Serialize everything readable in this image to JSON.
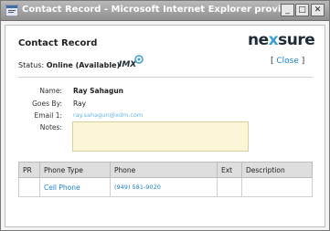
{
  "window": {
    "title": "Contact Record - Microsoft Internet Explorer provided by XDime...",
    "controls": {
      "minimize": "_",
      "maximize": "□",
      "close": "✕"
    }
  },
  "header": {
    "heading": "Contact Record",
    "logo_left": "ne",
    "logo_x": "x",
    "logo_right": "sure",
    "close_open": "[ ",
    "close_label": "Close",
    "close_close": " ]"
  },
  "status": {
    "label": "Status:",
    "value": "Online (Available)",
    "badge": "IMX"
  },
  "contact": {
    "name_label": "Name:",
    "name": "Ray Sahagun",
    "goes_by_label": "Goes By:",
    "goes_by": "Ray",
    "email_label": "Email 1:",
    "email": "ray.sahagun@xdm.com",
    "notes_label": "Notes:",
    "notes": ""
  },
  "phones": {
    "columns": [
      "PR",
      "Phone Type",
      "Phone",
      "Ext",
      "Description"
    ],
    "rows": [
      {
        "pr": "",
        "type": "Cell Phone",
        "phone": "(949) 581-9020",
        "ext": "",
        "description": ""
      }
    ]
  },
  "colors": {
    "accent": "#1d84c9",
    "titlebar": "#9a9a9a",
    "notes_bg": "#fbf6d8"
  }
}
